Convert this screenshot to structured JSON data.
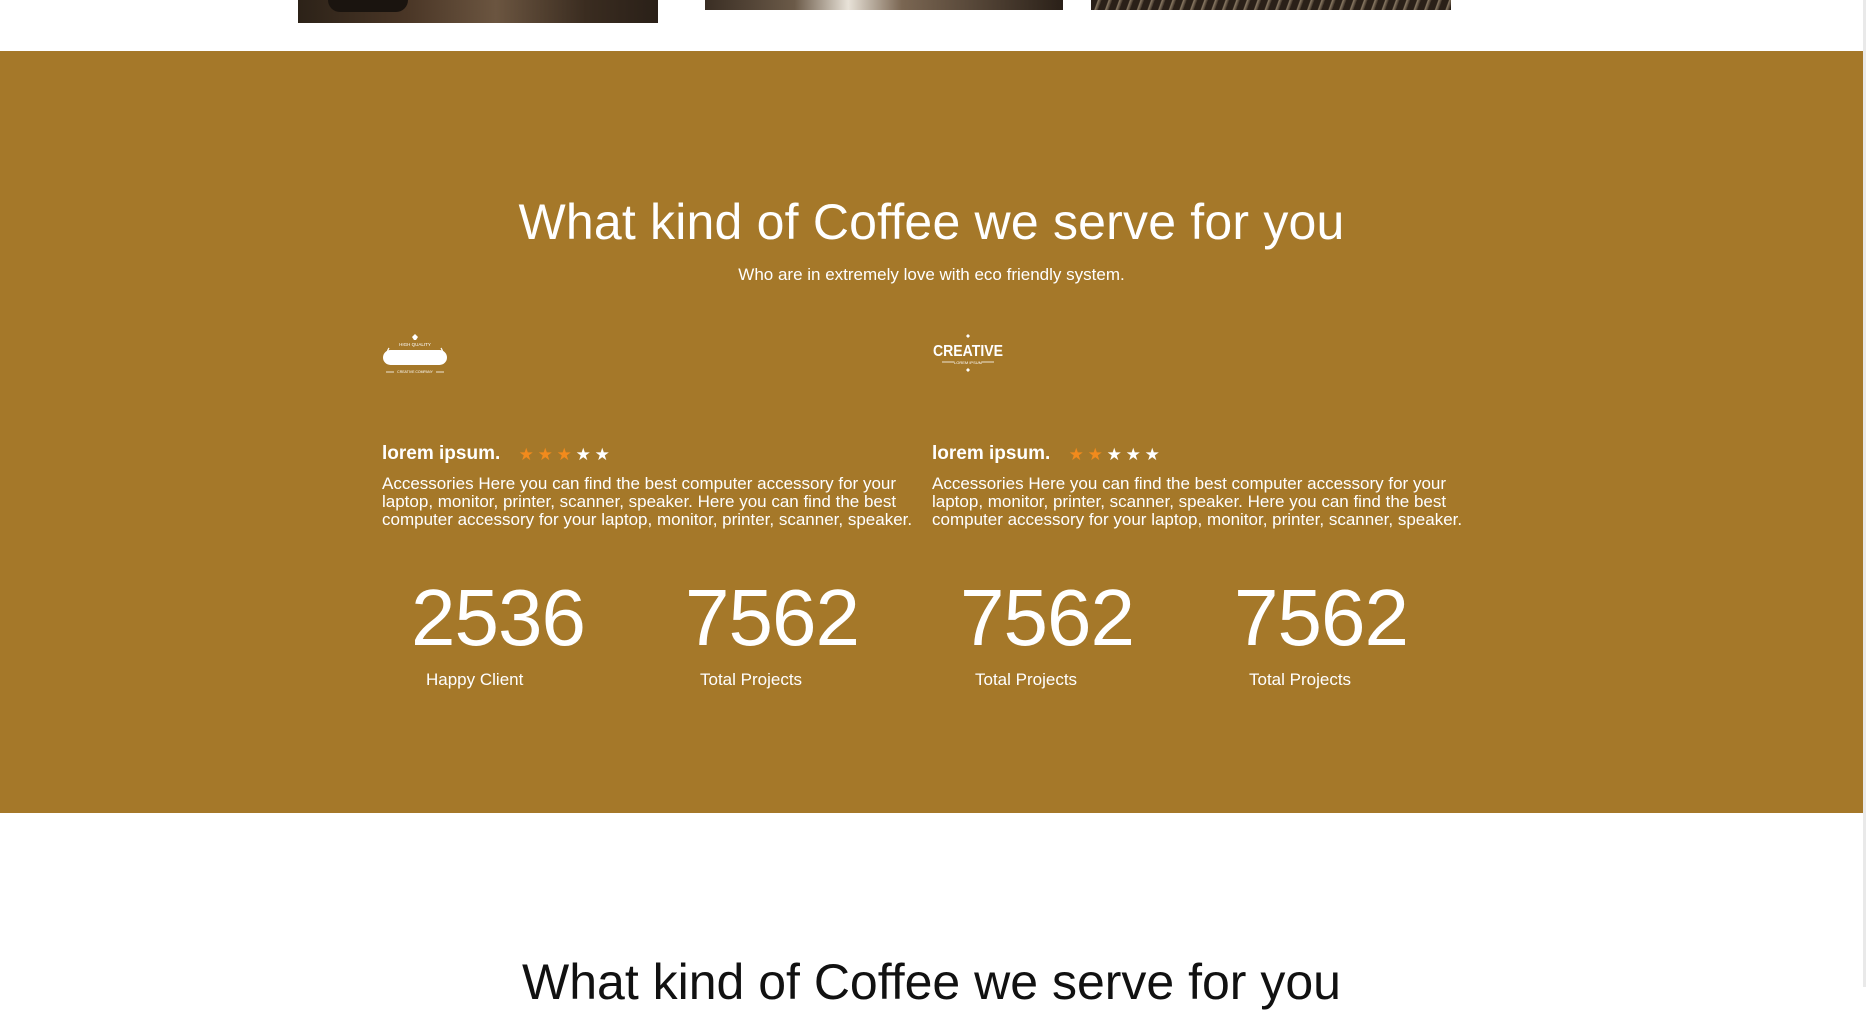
{
  "section": {
    "title": "What kind of Coffee we serve for you",
    "subtitle": "Who are in extremely love with eco friendly system."
  },
  "testimonials": [
    {
      "logo_top": "HIGH QUALITY",
      "logo_bottom": "CREATIVE COMPANY",
      "name": "lorem ipsum.",
      "rating": 3,
      "max_rating": 5,
      "text": "Accessories Here you can find the best computer accessory for your laptop, monitor, printer, scanner, speaker. Here you can find the best computer accessory for your laptop, monitor, printer, scanner, speaker."
    },
    {
      "logo_top": "CREATIVE",
      "logo_bottom": "LOREM IPSUM",
      "name": "lorem ipsum.",
      "rating": 2,
      "max_rating": 5,
      "text": "Accessories Here you can find the best computer accessory for your laptop, monitor, printer, scanner, speaker. Here you can find the best computer accessory for your laptop, monitor, printer, scanner, speaker."
    }
  ],
  "stats": [
    {
      "value": "2536",
      "label": "Happy Client"
    },
    {
      "value": "7562",
      "label": "Total Projects"
    },
    {
      "value": "7562",
      "label": "Total Projects"
    },
    {
      "value": "7562",
      "label": "Total Projects"
    }
  ],
  "lower_section": {
    "title": "What kind of Coffee we serve for you"
  },
  "colors": {
    "band_background": "#a57829",
    "star_active": "#f28a1c",
    "star_inactive": "#ffffff"
  },
  "icons": [
    "star-icon"
  ]
}
